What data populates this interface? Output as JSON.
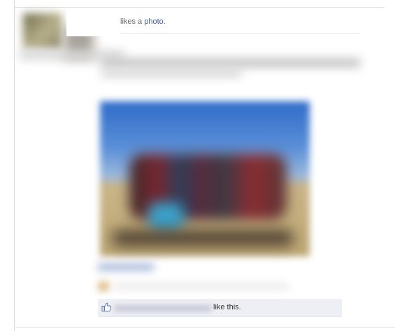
{
  "story": {
    "verb_text": "likes a ",
    "object_link": "photo",
    "end_punct": "."
  },
  "likes": {
    "suffix_text": "like this.",
    "icon": "thumbs-up-icon"
  },
  "colors": {
    "link": "#3b5998",
    "like_bar_bg": "#edeff4"
  }
}
